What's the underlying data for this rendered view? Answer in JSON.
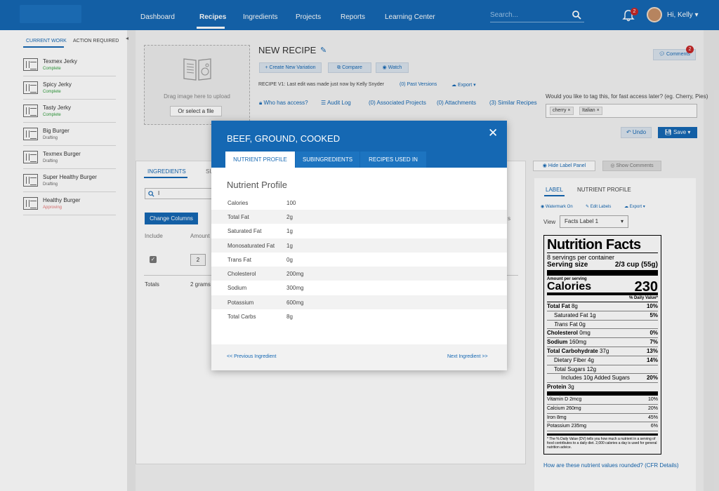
{
  "nav": {
    "items": [
      "Dashboard",
      "Recipes",
      "Ingredients",
      "Projects",
      "Reports",
      "Learning Center"
    ],
    "search_placeholder": "Search...",
    "notifications_count": "2",
    "user_greeting": "Hi, Kelly"
  },
  "sidebar": {
    "tabs": [
      "CURRENT WORK",
      "ACTION REQUIRED"
    ],
    "items": [
      {
        "name": "Texmex Jerky",
        "status": "Complete",
        "color": "#2e9c3a"
      },
      {
        "name": "Spicy Jerky",
        "status": "Complete",
        "color": "#2e9c3a"
      },
      {
        "name": "Tasty Jerky",
        "status": "Complete",
        "color": "#2e9c3a"
      },
      {
        "name": "Big Burger",
        "status": "Drafting",
        "color": "#666666"
      },
      {
        "name": "Texmex Burger",
        "status": "Drafting",
        "color": "#666666"
      },
      {
        "name": "Super Healthy Burger",
        "status": "Drafting",
        "color": "#666666"
      },
      {
        "name": "Healthy Burger",
        "status": "Approving",
        "color": "#e57373"
      }
    ]
  },
  "recipe": {
    "dropzone_text": "Drag image here to upload",
    "select_file": "Or select a file",
    "title": "NEW RECIPE",
    "create_variation": "+ Create New Variation",
    "compare": "Compare",
    "watch": "Watch",
    "meta": "RECIPE  V1: Last edit was made just now by Kelly Snyder",
    "past_versions": "(0) Past Versions",
    "export": "Export",
    "who_has_access": "Who has access?",
    "audit_log": "Audit Log",
    "associated_projects": "(0) Associated Projects",
    "attachments": "(0) Attachments",
    "similar_recipes": "(3) Similar Recipes",
    "tag_question": "Would you like to tag this, for fast access later? (eg. Cherry, Pies)",
    "tags": [
      "cherry",
      "Italian"
    ],
    "comments": "Comments",
    "comments_count": "2",
    "undo": "Undo",
    "save": "Save"
  },
  "ingredients": {
    "tabs": [
      "INGREDIENTS",
      "SU"
    ],
    "search_value": "I",
    "change_columns": "Change Columns",
    "col_include": "Include",
    "col_amount": "Amount",
    "amount_value": "2",
    "totals_label": "Totals",
    "totals_value": "2 grams",
    "partial_right": "s"
  },
  "label_panel": {
    "hide_label_panel": "Hide Label Panel",
    "show_comments": "Show Comments",
    "tabs": [
      "LABEL",
      "NUTRIENT PROFILE"
    ],
    "watermark": "Watermark On",
    "edit_labels": "Edit Labels",
    "export": "Export",
    "view_label": "View",
    "view_value": "Facts Label 1",
    "rounding_link": "How are these nutrient values rounded? (CFR Details)"
  },
  "nutrition_facts": {
    "heading": "Nutrition Facts",
    "servings": "8 servings per container",
    "serving_size_label": "Serving size",
    "serving_size_value": "2/3 cup (55g)",
    "amount_per_serving": "Amount per serving",
    "calories_label": "Calories",
    "calories_value": "230",
    "dv_header": "% Daily Value*",
    "rows": [
      {
        "label": "Total Fat",
        "amount": "8g",
        "dv": "10%",
        "indent": 0,
        "bold": true
      },
      {
        "label": "Saturated Fat",
        "amount": "1g",
        "dv": "5%",
        "indent": 1,
        "bold": false
      },
      {
        "label": "Trans",
        "amount": "Fat 0g",
        "dv": "",
        "indent": 1,
        "bold": false
      },
      {
        "label": "Cholesterol",
        "amount": "0mg",
        "dv": "0%",
        "indent": 0,
        "bold": true
      },
      {
        "label": "Sodium",
        "amount": "160mg",
        "dv": "7%",
        "indent": 0,
        "bold": true
      },
      {
        "label": "Total Carbohydrate",
        "amount": "37g",
        "dv": "13%",
        "indent": 0,
        "bold": true
      },
      {
        "label": "Dietary Fiber",
        "amount": "4g",
        "dv": "14%",
        "indent": 1,
        "bold": false
      },
      {
        "label": "Total Sugars",
        "amount": "12g",
        "dv": "",
        "indent": 1,
        "bold": false
      },
      {
        "label": "Includes 10g Added Sugars",
        "amount": "",
        "dv": "20%",
        "indent": 2,
        "bold": false
      },
      {
        "label": "Protein",
        "amount": "3g",
        "dv": "",
        "indent": 0,
        "bold": true
      }
    ],
    "vitamins": [
      {
        "label": "Vitamin D 2mcg",
        "dv": "10%"
      },
      {
        "label": "Calcium 260mg",
        "dv": "20%"
      },
      {
        "label": "Iron 8mg",
        "dv": "45%"
      },
      {
        "label": "Potassium 235mg",
        "dv": "6%"
      }
    ],
    "footnote": "* The % Daily Value (DV) tells you how much a nutrient in a serving of food contributes to a daily diet. 2,000 calories a day is used for general nutrition advice."
  },
  "modal": {
    "title": "BEEF, GROUND, COOKED",
    "tabs": [
      "NUTRIENT PROFILE",
      "SUBINGREDIENTS",
      "RECIPES USED IN"
    ],
    "section_title": "Nutrient Profile",
    "nutrients": [
      {
        "name": "Calories",
        "value": "100"
      },
      {
        "name": "Total Fat",
        "value": "2g"
      },
      {
        "name": "Saturated Fat",
        "value": "1g"
      },
      {
        "name": "Monosaturated Fat",
        "value": "1g"
      },
      {
        "name": "Trans Fat",
        "value": "0g"
      },
      {
        "name": "Cholesterol",
        "value": "200mg"
      },
      {
        "name": "Sodium",
        "value": "300mg"
      },
      {
        "name": "Potassium",
        "value": "600mg"
      },
      {
        "name": "Total Carbs",
        "value": "8g"
      }
    ],
    "prev": "<< Previous Ingredient",
    "next": "Next Ingredient >>"
  }
}
